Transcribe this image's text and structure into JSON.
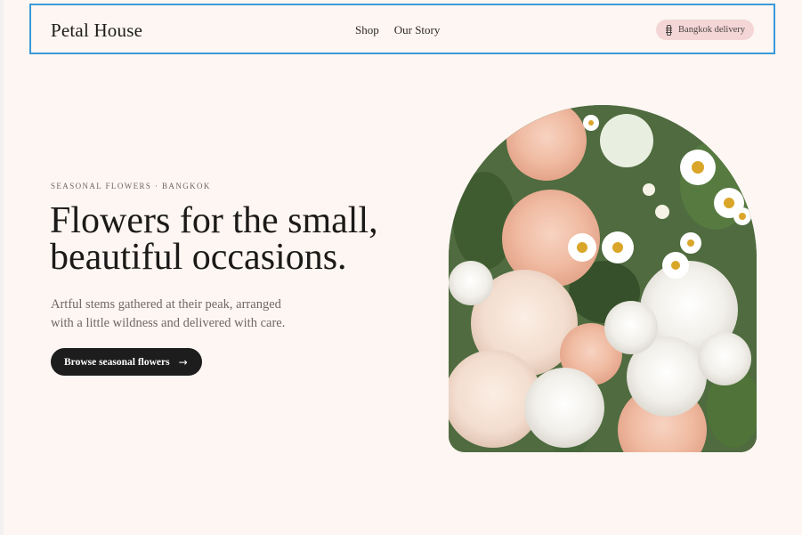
{
  "header": {
    "brand": "Petal House",
    "nav": [
      {
        "label": "Shop"
      },
      {
        "label": "Our Story"
      }
    ],
    "delivery_pill": {
      "label": "Bangkok delivery",
      "icon": "ribbon-icon"
    }
  },
  "hero": {
    "eyebrow": "SEASONAL FLOWERS · BANGKOK",
    "headline_line1": "Flowers for the small,",
    "headline_line2": "beautiful occasions.",
    "lede_line1": "Artful stems gathered at their peak, arranged",
    "lede_line2": "with a little wildness and delivered with care.",
    "cta": {
      "label": "Browse seasonal flowers",
      "icon": "arrow-right-icon"
    },
    "image": {
      "subject": "bouquet of peach carnations, white stock and daisies"
    }
  },
  "colors": {
    "page_bg": "#fdf6f2",
    "pill_bg": "#f4d6d6",
    "cta_bg": "#1d1d1d",
    "header_outline": "#3a9ad9"
  }
}
